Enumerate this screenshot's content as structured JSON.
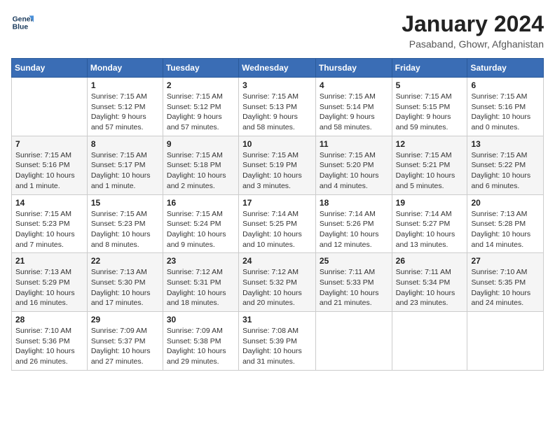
{
  "header": {
    "logo_line1": "General",
    "logo_line2": "Blue",
    "title": "January 2024",
    "subtitle": "Pasaband, Ghowr, Afghanistan"
  },
  "weekdays": [
    "Sunday",
    "Monday",
    "Tuesday",
    "Wednesday",
    "Thursday",
    "Friday",
    "Saturday"
  ],
  "weeks": [
    [
      {
        "day": "",
        "detail": ""
      },
      {
        "day": "1",
        "detail": "Sunrise: 7:15 AM\nSunset: 5:12 PM\nDaylight: 9 hours\nand 57 minutes."
      },
      {
        "day": "2",
        "detail": "Sunrise: 7:15 AM\nSunset: 5:12 PM\nDaylight: 9 hours\nand 57 minutes."
      },
      {
        "day": "3",
        "detail": "Sunrise: 7:15 AM\nSunset: 5:13 PM\nDaylight: 9 hours\nand 58 minutes."
      },
      {
        "day": "4",
        "detail": "Sunrise: 7:15 AM\nSunset: 5:14 PM\nDaylight: 9 hours\nand 58 minutes."
      },
      {
        "day": "5",
        "detail": "Sunrise: 7:15 AM\nSunset: 5:15 PM\nDaylight: 9 hours\nand 59 minutes."
      },
      {
        "day": "6",
        "detail": "Sunrise: 7:15 AM\nSunset: 5:16 PM\nDaylight: 10 hours\nand 0 minutes."
      }
    ],
    [
      {
        "day": "7",
        "detail": "Sunrise: 7:15 AM\nSunset: 5:16 PM\nDaylight: 10 hours\nand 1 minute."
      },
      {
        "day": "8",
        "detail": "Sunrise: 7:15 AM\nSunset: 5:17 PM\nDaylight: 10 hours\nand 1 minute."
      },
      {
        "day": "9",
        "detail": "Sunrise: 7:15 AM\nSunset: 5:18 PM\nDaylight: 10 hours\nand 2 minutes."
      },
      {
        "day": "10",
        "detail": "Sunrise: 7:15 AM\nSunset: 5:19 PM\nDaylight: 10 hours\nand 3 minutes."
      },
      {
        "day": "11",
        "detail": "Sunrise: 7:15 AM\nSunset: 5:20 PM\nDaylight: 10 hours\nand 4 minutes."
      },
      {
        "day": "12",
        "detail": "Sunrise: 7:15 AM\nSunset: 5:21 PM\nDaylight: 10 hours\nand 5 minutes."
      },
      {
        "day": "13",
        "detail": "Sunrise: 7:15 AM\nSunset: 5:22 PM\nDaylight: 10 hours\nand 6 minutes."
      }
    ],
    [
      {
        "day": "14",
        "detail": "Sunrise: 7:15 AM\nSunset: 5:23 PM\nDaylight: 10 hours\nand 7 minutes."
      },
      {
        "day": "15",
        "detail": "Sunrise: 7:15 AM\nSunset: 5:23 PM\nDaylight: 10 hours\nand 8 minutes."
      },
      {
        "day": "16",
        "detail": "Sunrise: 7:15 AM\nSunset: 5:24 PM\nDaylight: 10 hours\nand 9 minutes."
      },
      {
        "day": "17",
        "detail": "Sunrise: 7:14 AM\nSunset: 5:25 PM\nDaylight: 10 hours\nand 10 minutes."
      },
      {
        "day": "18",
        "detail": "Sunrise: 7:14 AM\nSunset: 5:26 PM\nDaylight: 10 hours\nand 12 minutes."
      },
      {
        "day": "19",
        "detail": "Sunrise: 7:14 AM\nSunset: 5:27 PM\nDaylight: 10 hours\nand 13 minutes."
      },
      {
        "day": "20",
        "detail": "Sunrise: 7:13 AM\nSunset: 5:28 PM\nDaylight: 10 hours\nand 14 minutes."
      }
    ],
    [
      {
        "day": "21",
        "detail": "Sunrise: 7:13 AM\nSunset: 5:29 PM\nDaylight: 10 hours\nand 16 minutes."
      },
      {
        "day": "22",
        "detail": "Sunrise: 7:13 AM\nSunset: 5:30 PM\nDaylight: 10 hours\nand 17 minutes."
      },
      {
        "day": "23",
        "detail": "Sunrise: 7:12 AM\nSunset: 5:31 PM\nDaylight: 10 hours\nand 18 minutes."
      },
      {
        "day": "24",
        "detail": "Sunrise: 7:12 AM\nSunset: 5:32 PM\nDaylight: 10 hours\nand 20 minutes."
      },
      {
        "day": "25",
        "detail": "Sunrise: 7:11 AM\nSunset: 5:33 PM\nDaylight: 10 hours\nand 21 minutes."
      },
      {
        "day": "26",
        "detail": "Sunrise: 7:11 AM\nSunset: 5:34 PM\nDaylight: 10 hours\nand 23 minutes."
      },
      {
        "day": "27",
        "detail": "Sunrise: 7:10 AM\nSunset: 5:35 PM\nDaylight: 10 hours\nand 24 minutes."
      }
    ],
    [
      {
        "day": "28",
        "detail": "Sunrise: 7:10 AM\nSunset: 5:36 PM\nDaylight: 10 hours\nand 26 minutes."
      },
      {
        "day": "29",
        "detail": "Sunrise: 7:09 AM\nSunset: 5:37 PM\nDaylight: 10 hours\nand 27 minutes."
      },
      {
        "day": "30",
        "detail": "Sunrise: 7:09 AM\nSunset: 5:38 PM\nDaylight: 10 hours\nand 29 minutes."
      },
      {
        "day": "31",
        "detail": "Sunrise: 7:08 AM\nSunset: 5:39 PM\nDaylight: 10 hours\nand 31 minutes."
      },
      {
        "day": "",
        "detail": ""
      },
      {
        "day": "",
        "detail": ""
      },
      {
        "day": "",
        "detail": ""
      }
    ]
  ]
}
